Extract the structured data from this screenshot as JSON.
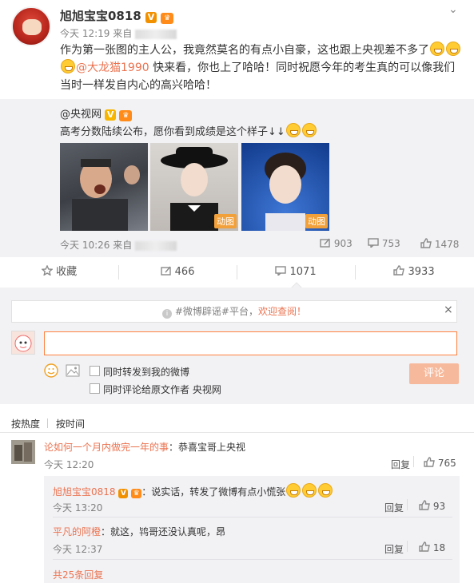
{
  "post": {
    "username": "旭旭宝宝0818",
    "time": "今天 12:19 来自",
    "text_line1": "作为第一张图的主人公，我竟然莫名的有点小自豪，这也跟上央视差不多了",
    "mention": "@大龙猫1990",
    "text_line2_rest": " 快来看，你也上了哈哈！同时祝愿今年的考生真的可以像我们",
    "text_line3": "当时一样发自内心的高兴哈哈！"
  },
  "repost": {
    "author": "@央视网",
    "text": "高考分数陆续公布，愿你看到成绩是这个样子↓↓",
    "gif_label": "动图",
    "time": "今天 10:26 来自",
    "stats": {
      "forward": "903",
      "comment": "753",
      "like": "1478"
    }
  },
  "actions": {
    "favorite": "收藏",
    "forward": "466",
    "comment": "1071",
    "like": "3933"
  },
  "comment_form": {
    "notice_hashtag": "#微博辟谣#平台，",
    "notice_link": "欢迎查阅！",
    "input_placeholder": "",
    "option1": "同时转发到我的微博",
    "option2": "同时评论给原文作者 央视网",
    "submit": "评论"
  },
  "sort": {
    "hot": "按热度",
    "time": "按时间"
  },
  "comments": [
    {
      "name": "论如何一个月内做完一年的事",
      "text": "：恭喜宝哥上央视",
      "time": "今天 12:20",
      "reply": "回复",
      "likes": "765"
    }
  ],
  "replies": [
    {
      "name": "旭旭宝宝0818",
      "text": "：说实话，转发了微博有点小慌张",
      "time": "今天 13:20",
      "reply": "回复",
      "likes": "93"
    },
    {
      "name": "平凡的阿橙",
      "text": "：就这，鸨哥还没认真呢，昂",
      "time": "今天 12:37",
      "reply": "回复",
      "likes": "18"
    }
  ],
  "more_replies": "共25条回复",
  "colors": {
    "accent": "#eb7350",
    "link": "#eb7350",
    "submit": "#f7b99b"
  }
}
